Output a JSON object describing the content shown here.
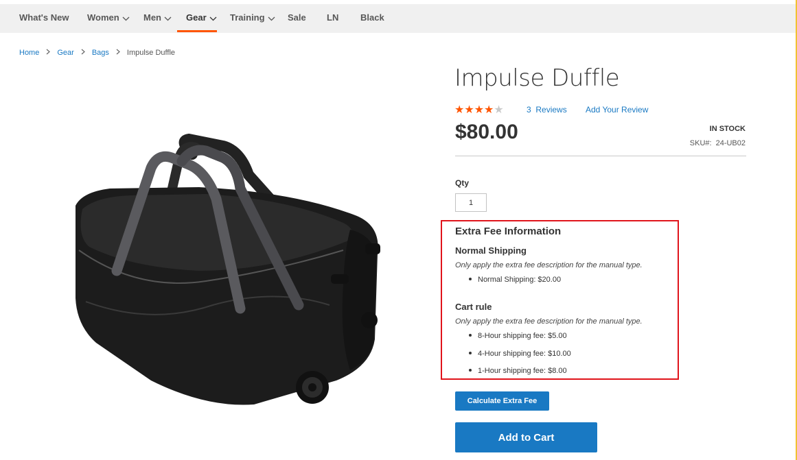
{
  "nav": {
    "items": [
      {
        "label": "What's New",
        "has_dropdown": false
      },
      {
        "label": "Women",
        "has_dropdown": true
      },
      {
        "label": "Men",
        "has_dropdown": true
      },
      {
        "label": "Gear",
        "has_dropdown": true,
        "active": true
      },
      {
        "label": "Training",
        "has_dropdown": true
      },
      {
        "label": "Sale",
        "has_dropdown": false
      },
      {
        "label": "LN",
        "has_dropdown": false
      },
      {
        "label": "Black",
        "has_dropdown": false
      }
    ]
  },
  "breadcrumb": {
    "items": [
      "Home",
      "Gear",
      "Bags"
    ],
    "current": "Impulse Duffle"
  },
  "product": {
    "name": "Impulse Duffle",
    "rating": {
      "stars": 4,
      "max": 5
    },
    "reviews_count": "3",
    "reviews_label": "Reviews",
    "add_review": "Add Your Review",
    "price": "$80.00",
    "stock": "In stock",
    "sku_label": "SKU#:",
    "sku": "24-UB02",
    "qty_label": "Qty",
    "qty_value": "1"
  },
  "extra_fee": {
    "title": "Extra Fee Information",
    "sections": [
      {
        "title": "Normal Shipping",
        "description": "Only apply the extra fee description for the manual type.",
        "items": [
          "Normal Shipping: $20.00"
        ]
      },
      {
        "title": "Cart rule",
        "description": "Only apply the extra fee description for the manual type.",
        "items": [
          "8-Hour shipping fee: $5.00",
          "4-Hour shipping fee: $10.00",
          "1-Hour shipping fee: $8.00"
        ]
      }
    ]
  },
  "buttons": {
    "calculate": "Calculate Extra Fee",
    "add_to_cart": "Add to Cart"
  },
  "colors": {
    "accent": "#ff5501",
    "link": "#1979c3",
    "highlight_border": "#e0131a"
  }
}
